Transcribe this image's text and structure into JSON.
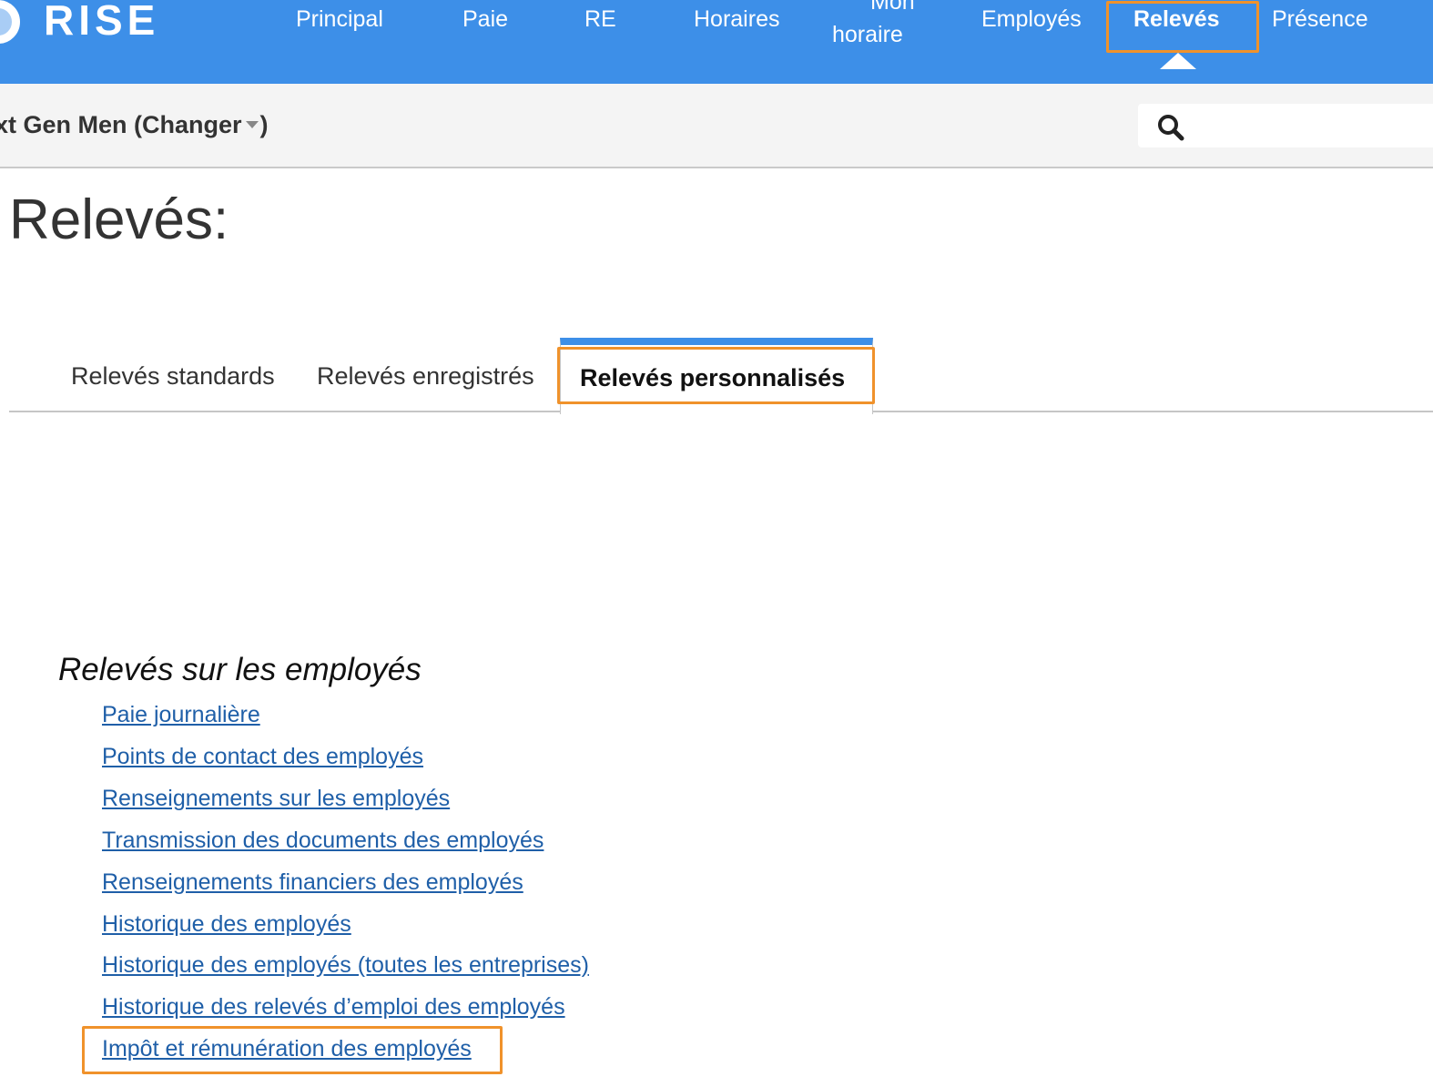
{
  "brand": {
    "logo_text": "RISE"
  },
  "nav": {
    "items": [
      {
        "label": "Principal"
      },
      {
        "label": "Paie"
      },
      {
        "label": "RE"
      },
      {
        "label": "Horaires"
      },
      {
        "label_line1": "Mon",
        "label_line2": "horaire"
      },
      {
        "label": "Employés"
      },
      {
        "label": "Relevés",
        "active": true
      },
      {
        "label": "Présence"
      }
    ]
  },
  "subbar": {
    "company_label": "xt Gen Men (Changer",
    "company_close": ")",
    "search_placeholder": ""
  },
  "page": {
    "title": "Relevés:"
  },
  "tabs": [
    {
      "label": "Relevés standards"
    },
    {
      "label": "Relevés enregistrés"
    },
    {
      "label": "Relevés personnalisés",
      "active": true
    }
  ],
  "section": {
    "title": "Relevés sur les employés",
    "links": [
      {
        "label": "Paie journalière"
      },
      {
        "label": "Points de contact des employés"
      },
      {
        "label": "Renseignements sur les employés"
      },
      {
        "label": "Transmission des documents des employés"
      },
      {
        "label": "Renseignements financiers des employés"
      },
      {
        "label": "Historique des employés"
      },
      {
        "label": "Historique des employés (toutes les entreprises)"
      },
      {
        "label": "Historique des relevés d’emploi des employés"
      },
      {
        "label": "Impôt et rémunération des employés"
      }
    ]
  },
  "colors": {
    "topbar": "#3d8fe8",
    "highlight": "#f0922b",
    "link": "#1f5fa8"
  },
  "icons": [
    "logo-icon",
    "search-icon",
    "dropdown-caret-icon",
    "active-nav-caret-icon"
  ]
}
